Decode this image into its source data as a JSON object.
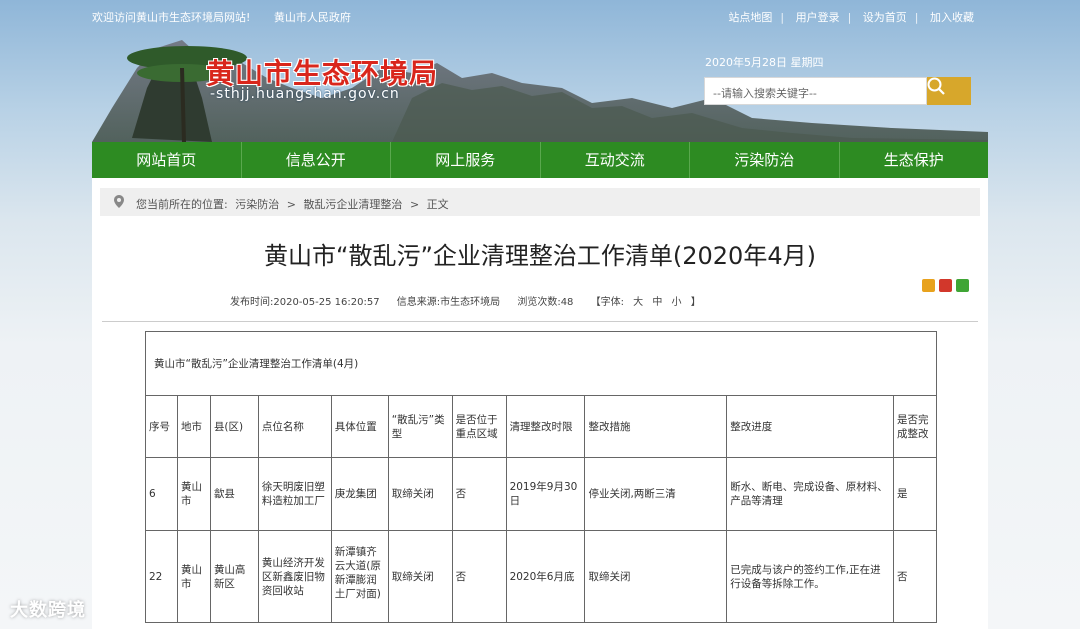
{
  "topbar": {
    "welcome": "欢迎访问黄山市生态环境局网站!",
    "gov_link": "黄山市人民政府",
    "links": [
      "站点地图",
      "用户登录",
      "设为首页",
      "加入收藏"
    ]
  },
  "header": {
    "site_name": "黄山市生态环境局",
    "site_url": "-sthjj.huangshan.gov.cn",
    "date": "2020年5月28日 星期四",
    "search_placeholder": "--请输入搜索关键字--"
  },
  "nav": [
    "网站首页",
    "信息公开",
    "网上服务",
    "互动交流",
    "污染防治",
    "生态保护"
  ],
  "breadcrumb": {
    "prefix": "您当前所在的位置:",
    "items": [
      "污染防治",
      ">",
      "散乱污企业清理整治",
      ">",
      "正文"
    ]
  },
  "article": {
    "title": "黄山市“散乱污”企业清理整治工作清单(2020年4月)",
    "publish_time": "发布时间:2020-05-25 16:20:57",
    "source": "信息来源:市生态环境局",
    "views": "浏览次数:48",
    "font_label": "【字体:",
    "font_sizes": [
      "大",
      "中",
      "小"
    ],
    "font_close": "】"
  },
  "table": {
    "caption": "黄山市“散乱污”企业清理整治工作清单(4月)",
    "headers": [
      "序号",
      "地市",
      "县(区)",
      "点位名称",
      "具体位置",
      "“散乱污”类型",
      "是否位于重点区域",
      "清理整改时限",
      "整改措施",
      "整改进度",
      "是否完成整改"
    ],
    "rows": [
      [
        "6",
        "黄山市",
        "歙县",
        "徐天明废旧塑料造粒加工厂",
        "庚龙集团",
        "取缔关闭",
        "否",
        "2019年9月30日",
        "停业关闭,两断三清",
        "断水、断电、完成设备、原材料、产品等清理",
        "是"
      ],
      [
        "22",
        "黄山市",
        "黄山高新区",
        "黄山经济开发区新鑫废旧物资回收站",
        "新潭镇齐云大道(原新潭膨润土厂对面)",
        "取缔关闭",
        "否",
        "2020年6月底",
        "取缔关闭",
        "已完成与该户的签约工作,正在进行设备等拆除工作。",
        "否"
      ]
    ]
  },
  "colors": {
    "nav_green": "#2d8b22",
    "title_red": "#d9261c",
    "search_gold": "#d7a72b"
  },
  "watermark": "大数跨境"
}
